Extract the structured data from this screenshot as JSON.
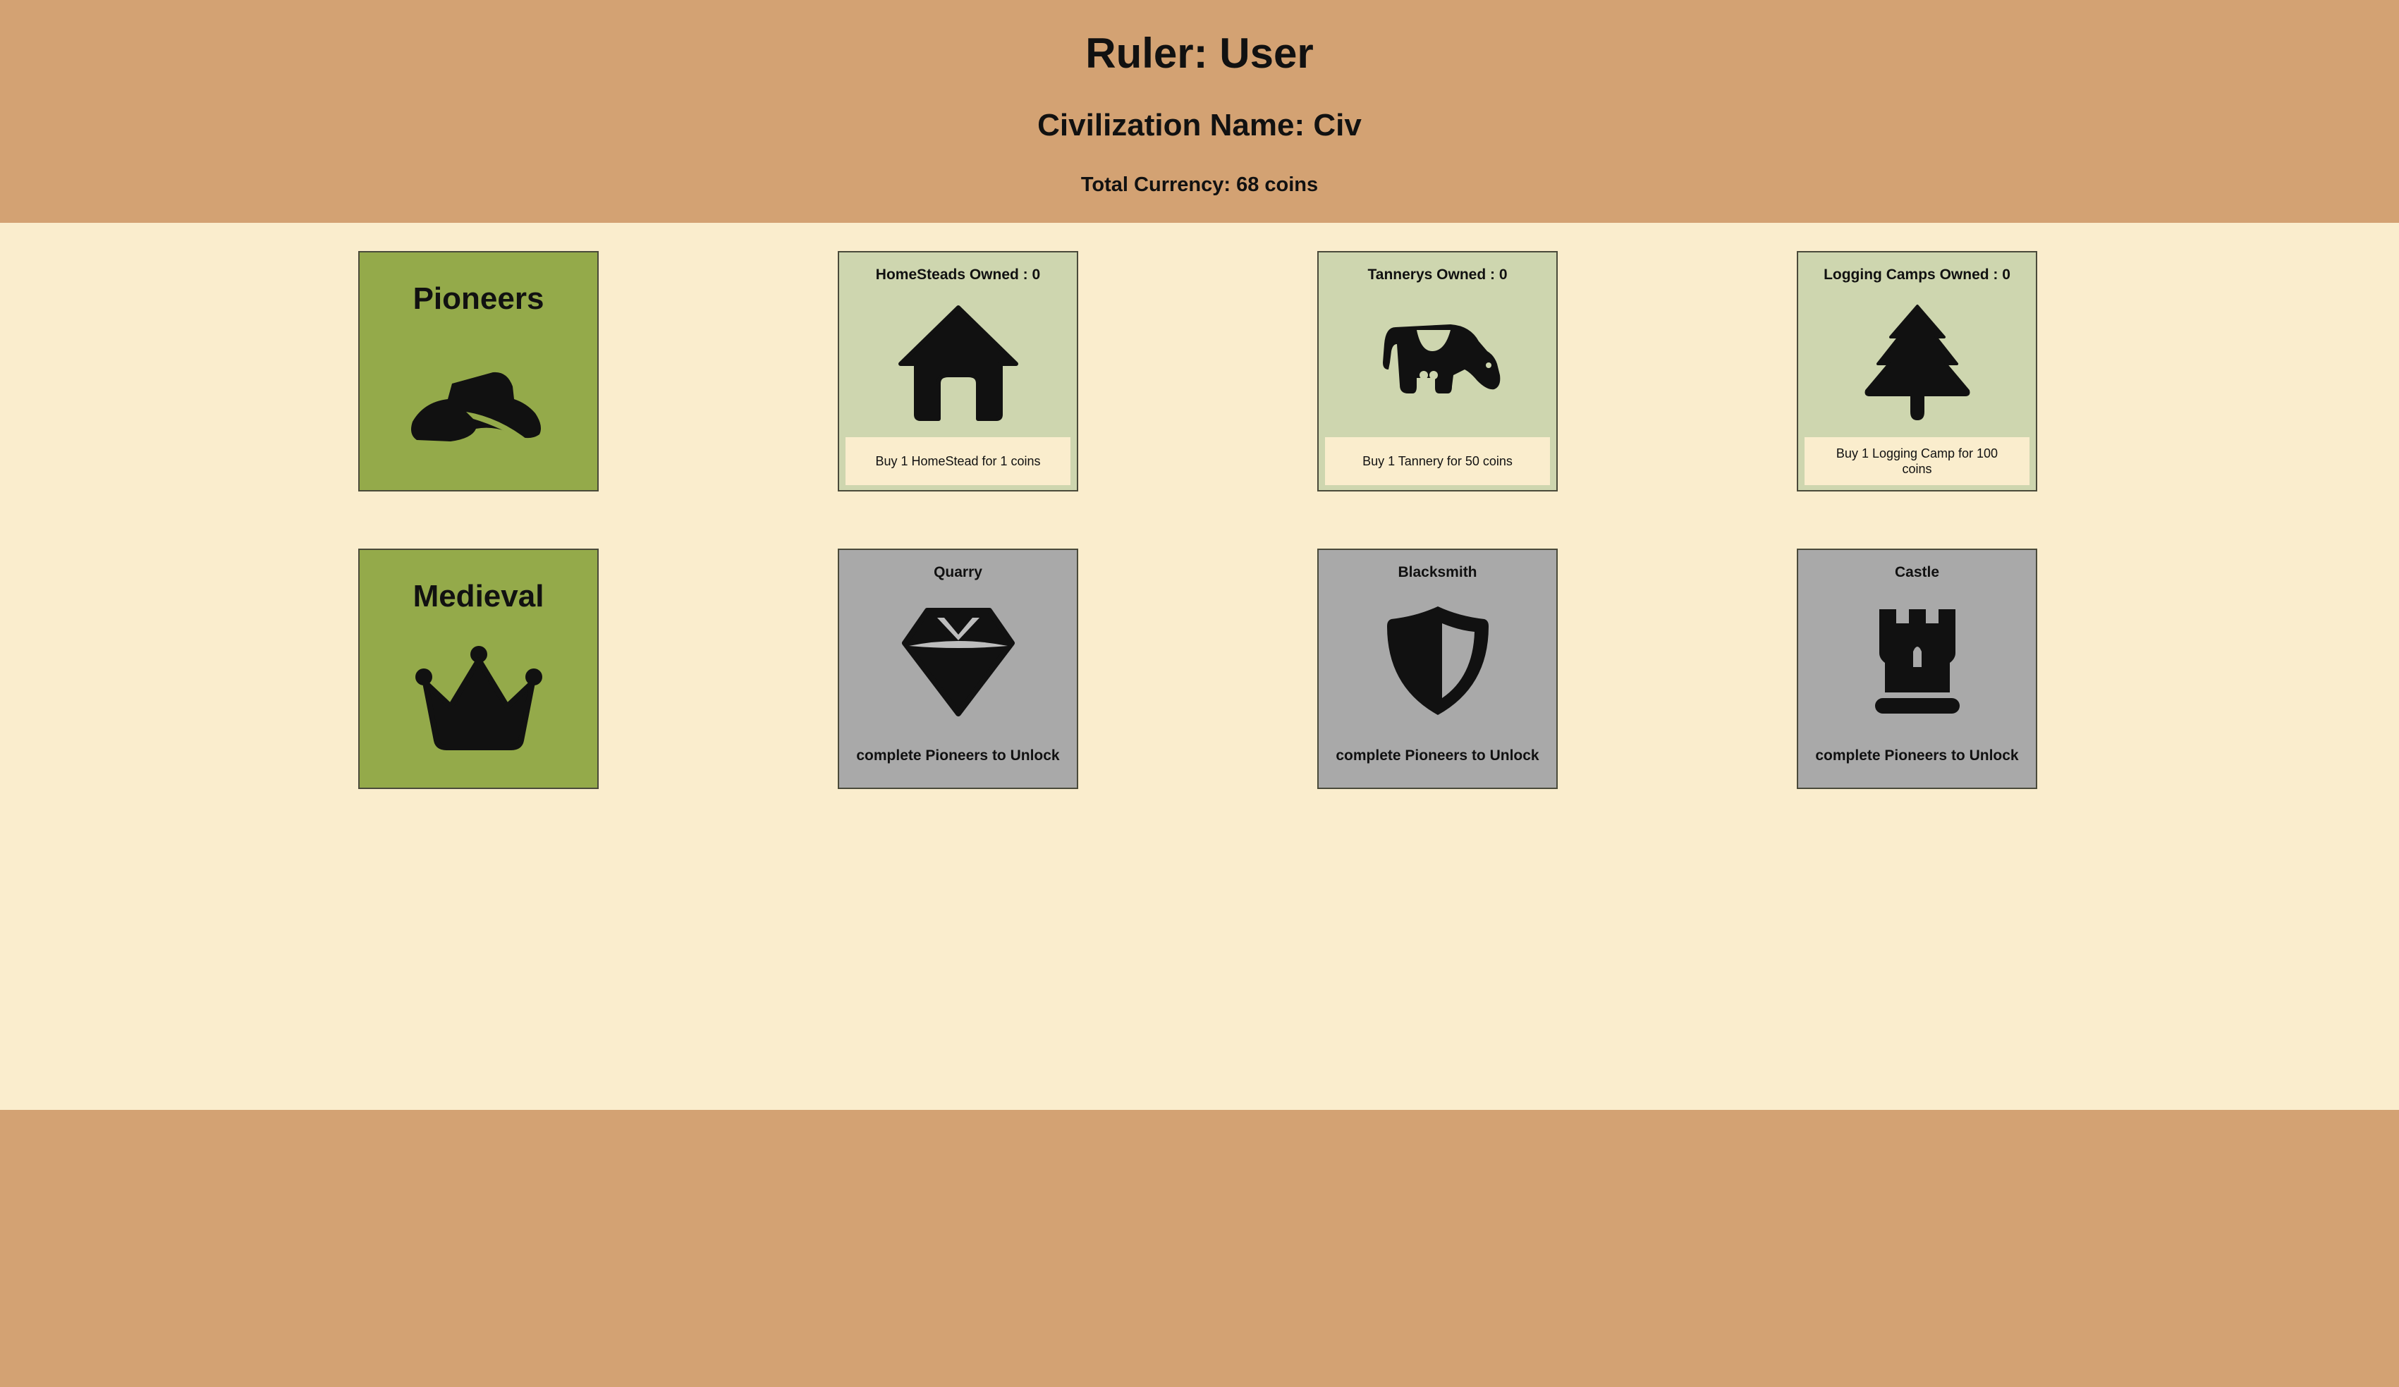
{
  "header": {
    "ruler": "Ruler: User",
    "civilization": "Civilization Name: Civ",
    "currency": "Total Currency: 68 coins"
  },
  "eras": [
    {
      "title": "Pioneers",
      "icon": "cowboy-hat-icon"
    },
    {
      "title": "Medieval",
      "icon": "crown-icon"
    }
  ],
  "buildings": [
    {
      "title": "HomeSteads Owned : 0",
      "icon": "house-icon",
      "buy_label": "Buy 1 HomeStead for 1 coins"
    },
    {
      "title": "Tannerys Owned : 0",
      "icon": "cow-icon",
      "buy_label": "Buy 1 Tannery for 50 coins"
    },
    {
      "title": "Logging Camps Owned : 0",
      "icon": "tree-icon",
      "buy_label": "Buy 1 Logging Camp for 100 coins"
    }
  ],
  "locked": [
    {
      "title": "Quarry",
      "icon": "gem-icon",
      "lock_label": "complete Pioneers to Unlock"
    },
    {
      "title": "Blacksmith",
      "icon": "shield-icon",
      "lock_label": "complete Pioneers to Unlock"
    },
    {
      "title": "Castle",
      "icon": "chess-rook-icon",
      "lock_label": "complete Pioneers to Unlock"
    }
  ],
  "colors": {
    "header_bg": "#D3A273",
    "main_bg": "#FAEDCD",
    "era_card": "#94AA4A",
    "building_card": "#CED6AF",
    "locked_card": "#A9A9A9"
  }
}
